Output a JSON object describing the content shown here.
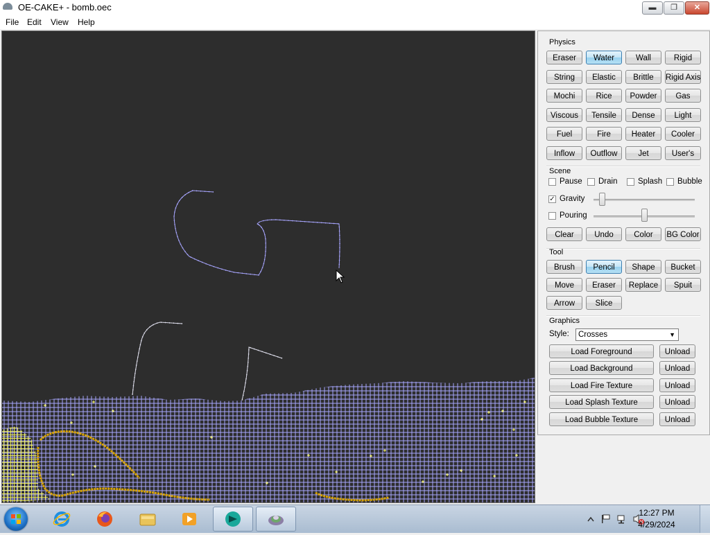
{
  "window": {
    "title": "OE-CAKE+ - bomb.oec"
  },
  "window_controls": {
    "minimize": "▬",
    "maximize": "❐",
    "close": "✕"
  },
  "menu": [
    "File",
    "Edit",
    "View",
    "Help"
  ],
  "physics": {
    "label": "Physics",
    "buttons": [
      "Eraser",
      "Water",
      "Wall",
      "Rigid",
      "String",
      "Elastic",
      "Brittle",
      "Rigid Axis",
      "Mochi",
      "Rice",
      "Powder",
      "Gas",
      "Viscous",
      "Tensile",
      "Dense",
      "Light",
      "Fuel",
      "Fire",
      "Heater",
      "Cooler",
      "Inflow",
      "Outflow",
      "Jet",
      "User's"
    ],
    "selected": "Water"
  },
  "scene": {
    "label": "Scene",
    "pause": "Pause",
    "drain": "Drain",
    "splash": "Splash",
    "bubble": "Bubble",
    "gravity": "Gravity",
    "pouring": "Pouring",
    "gravity_checked": true,
    "pouring_checked": false,
    "buttons": [
      "Clear",
      "Undo",
      "Color",
      "BG Color"
    ]
  },
  "tool": {
    "label": "Tool",
    "buttons": [
      "Brush",
      "Pencil",
      "Shape",
      "Bucket",
      "Move",
      "Eraser",
      "Replace",
      "Spuit",
      "Arrow",
      "Slice"
    ],
    "selected": "Pencil"
  },
  "graphics": {
    "label": "Graphics",
    "style_label": "Style:",
    "style_value": "Crosses",
    "loaders": [
      {
        "load": "Load Foreground",
        "unload": "Unload"
      },
      {
        "load": "Load Background",
        "unload": "Unload"
      },
      {
        "load": "Load Fire Texture",
        "unload": "Unload"
      },
      {
        "load": "Load Splash Texture",
        "unload": "Unload"
      },
      {
        "load": "Load Bubble Texture",
        "unload": "Unload"
      }
    ]
  },
  "colors": {
    "canvas_bg": "#2d2d2d",
    "water": "#a8a6ff",
    "wall": "#e2e2f0",
    "gas": "#ffff66",
    "fuel": "#d9a400",
    "accent": "#3c7fb1"
  },
  "taskbar": {
    "apps": [
      "start-orb",
      "internet-explorer-icon",
      "firefox-icon",
      "file-explorer-icon",
      "media-player-icon",
      "oe-cake-icon",
      "oe-cake-window-icon"
    ],
    "time": "12:27 PM",
    "date": "4/29/2024"
  }
}
